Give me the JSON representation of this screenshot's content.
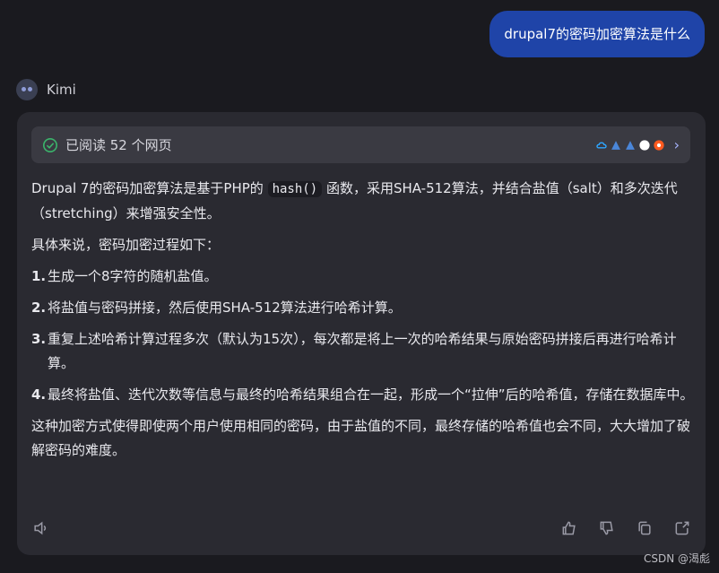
{
  "user": {
    "question": "drupal7的密码加密算法是什么"
  },
  "bot": {
    "name": "Kimi"
  },
  "sources": {
    "label": "已阅读 52 个网页",
    "icons": [
      "cloud-icon",
      "blue-a-icon",
      "blue-a-icon",
      "white-circle-icon",
      "orange-circle-icon"
    ],
    "chevron": "›"
  },
  "answer": {
    "p1_pre": "Drupal 7的密码加密算法是基于PHP的",
    "p1_code": "hash()",
    "p1_post": "函数，采用SHA-512算法，并结合盐值（salt）和多次迭代（stretching）来增强安全性。",
    "p2": "具体来说，密码加密过程如下：",
    "steps": [
      {
        "num": "1.",
        "text": "生成一个8字符的随机盐值。"
      },
      {
        "num": "2.",
        "text": "将盐值与密码拼接，然后使用SHA-512算法进行哈希计算。"
      },
      {
        "num": "3.",
        "text": "重复上述哈希计算过程多次（默认为15次），每次都是将上一次的哈希结果与原始密码拼接后再进行哈希计算。"
      },
      {
        "num": "4.",
        "text": "最终将盐值、迭代次数等信息与最终的哈希结果组合在一起，形成一个“拉伸”后的哈希值，存储在数据库中。"
      }
    ],
    "p3": "这种加密方式使得即使两个用户使用相同的密码，由于盐值的不同，最终存储的哈希值也会不同，大大增加了破解密码的难度。"
  },
  "watermark": "CSDN @渴彪",
  "colors": {
    "accent_blue": "#1f44a8",
    "card_bg": "#2a2a31",
    "page_bg": "#1a1a1f",
    "check_green": "#3bb36b"
  }
}
